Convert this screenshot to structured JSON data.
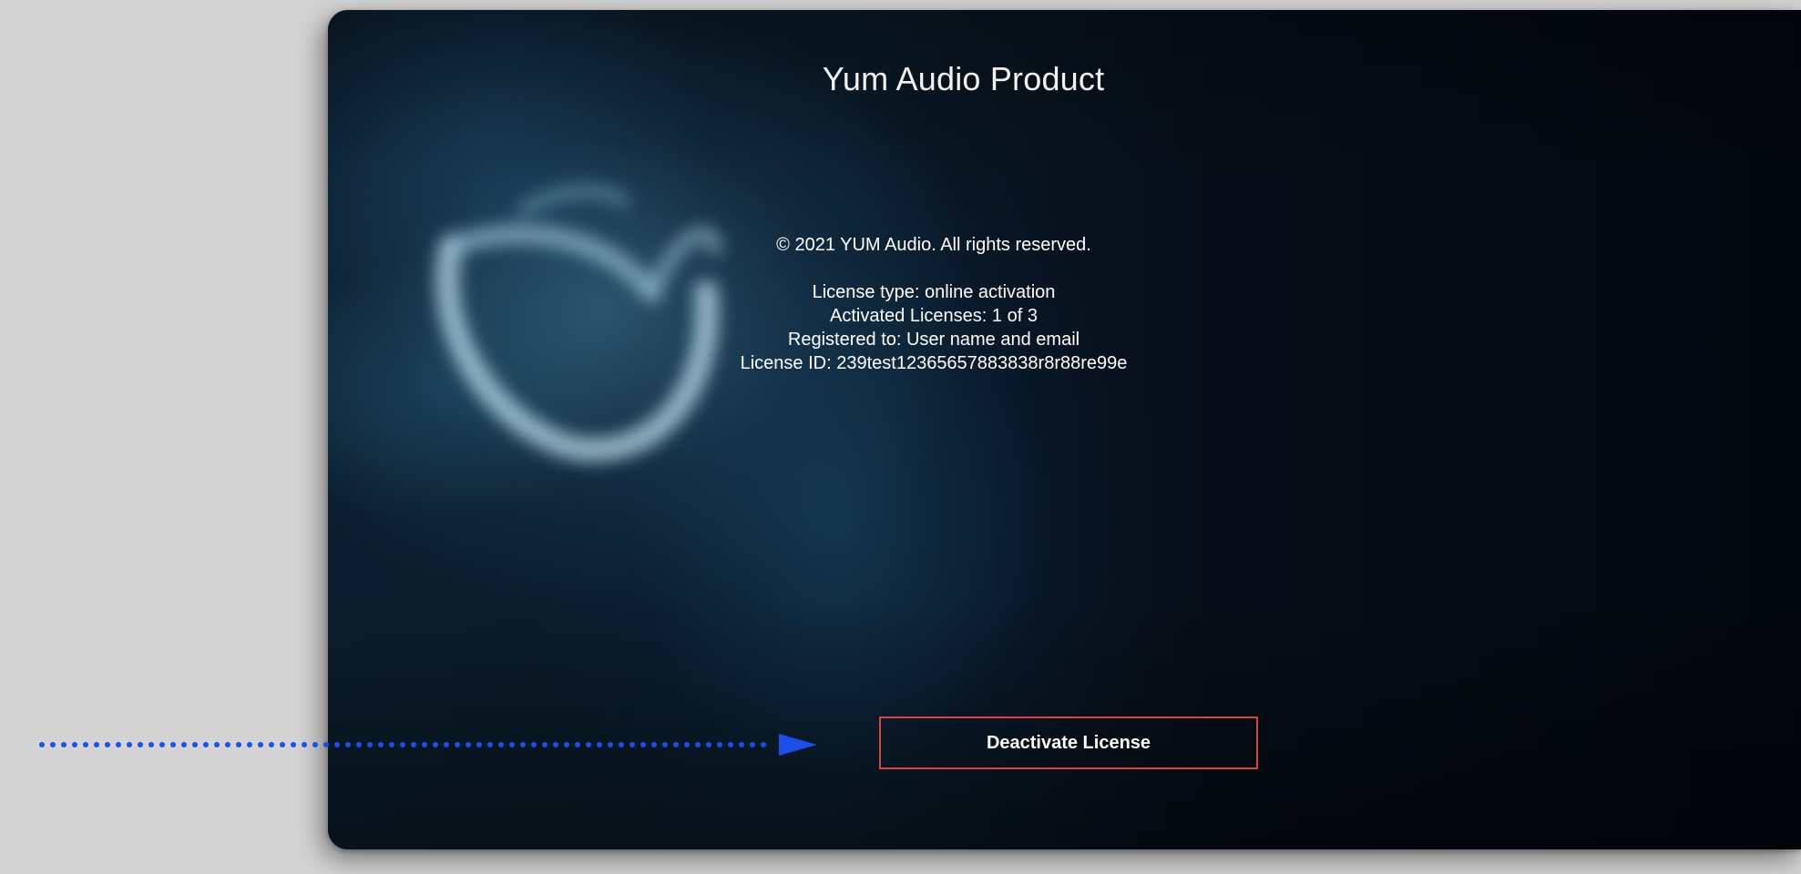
{
  "window": {
    "title": "Yum Audio Product"
  },
  "about": {
    "copyright": "© 2021 YUM Audio. All rights reserved.",
    "license_type": "License type: online activation",
    "activated_licenses": "Activated Licenses: 1 of 3",
    "registered_to": "Registered to: User name and email",
    "license_id": "License ID:  239test12365657883838r8r88re99e"
  },
  "actions": {
    "deactivate_label": "Deactivate License"
  },
  "colors": {
    "button_border": "#d9453a",
    "pointer_arrow": "#1d4fe8",
    "background_outer": "#d3d3d3",
    "window_background": "#05080f"
  },
  "icons": {
    "annotation": "dotted-arrow-icon",
    "logo": "yum-audio-logo-icon"
  }
}
